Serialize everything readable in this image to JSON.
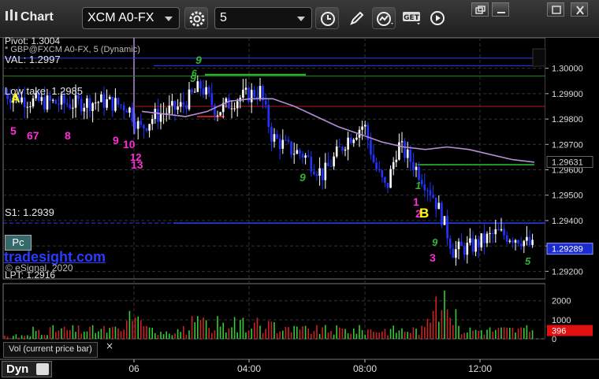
{
  "window": {
    "title": "Chart"
  },
  "toolbar": {
    "symbol": "XCM A0-FX",
    "interval": "5",
    "icons": [
      "settings-gear-icon",
      "clock-icon",
      "pencil-icon",
      "study-icon",
      "get-icon",
      "play-icon",
      "restore-icon",
      "minimize-icon",
      "maximize-icon",
      "close-icon"
    ],
    "get_label": "GET"
  },
  "legend": {
    "pivot": "Pivot: 1.3004",
    "study": "* GBP@FXCM A0-FX, 5 (Dynamic)",
    "val": "VAL: 1.2997",
    "lowtake": "Low take: 1.2985",
    "s1": "S1: 1.2939",
    "lpt": "LPT: 1.2916"
  },
  "brand": {
    "logo": "tradesight.com",
    "copyright": "© eSignal, 2020",
    "pc": "Pc"
  },
  "volume_panel": {
    "legend": "Vol (current price bar)",
    "last_volume_label": "396",
    "close_glyph": "×"
  },
  "bottom": {
    "dyn_label": "Dyn"
  },
  "colors": {
    "up": "#ffffff",
    "down": "#2233ff",
    "ma": "#b58ed8",
    "magenta": "#ff2bd6",
    "green_count": "#35b135",
    "yellow": "#ffff00",
    "resistance": "#2a3cff",
    "last_price_bg": "#1a2bd0",
    "vol_badge_bg": "#e01010"
  },
  "annotations": [
    {
      "text": "A",
      "color": "yellow"
    },
    {
      "text": "5",
      "color": "magenta"
    },
    {
      "text": "67",
      "color": "magenta"
    },
    {
      "text": "8",
      "color": "magenta"
    },
    {
      "text": "9",
      "color": "magenta"
    },
    {
      "text": "10",
      "color": "magenta"
    },
    {
      "text": "12",
      "color": "magenta"
    },
    {
      "text": "13",
      "color": "magenta"
    },
    {
      "text": "1",
      "color": "magenta"
    },
    {
      "text": "2",
      "color": "magenta"
    },
    {
      "text": "3",
      "color": "magenta"
    },
    {
      "text": "B",
      "color": "yellow"
    },
    {
      "text": "9",
      "color": "green"
    },
    {
      "text": "9",
      "color": "green"
    },
    {
      "text": "6",
      "color": "green"
    },
    {
      "text": "9",
      "color": "green"
    },
    {
      "text": "1",
      "color": "green"
    },
    {
      "text": "9",
      "color": "green"
    },
    {
      "text": "5",
      "color": "green"
    },
    {
      "text": "1",
      "color": "green"
    }
  ],
  "chart_data": {
    "type": "candlestick",
    "title": "",
    "price_axis": {
      "ylim": [
        1.2917,
        1.3012
      ],
      "ticks": [
        "1.30000",
        "1.29900",
        "1.29800",
        "1.29700",
        "1.29600",
        "1.29500",
        "1.29400",
        "1.29300",
        "1.29200"
      ]
    },
    "time_axis": {
      "ticks": [
        "06",
        "04:00",
        "08:00",
        "12:00"
      ]
    },
    "levels": [
      {
        "name": "Pivot",
        "value": 1.3004
      },
      {
        "name": "VAL",
        "value": 1.2997
      },
      {
        "name": "Low take",
        "value": 1.2985
      },
      {
        "name": "S1",
        "value": 1.2939
      },
      {
        "name": "LPT",
        "value": 1.2916
      }
    ],
    "price_labels": [
      {
        "label": "1.29631",
        "value": 1.29631
      },
      {
        "label": "1.29289",
        "value": 1.29289
      }
    ],
    "moving_average": [
      1.2983,
      1.2982,
      1.2981,
      1.2983,
      1.2987,
      1.2988,
      1.2988,
      1.2985,
      1.2981,
      1.2977,
      1.2974,
      1.2971,
      1.2969,
      1.2968,
      1.2969,
      1.2968,
      1.2966,
      1.2964,
      1.2963
    ],
    "volume": {
      "ylim": [
        0,
        2900
      ],
      "ticks": [
        "2000",
        "1000",
        "0"
      ],
      "last": 396
    }
  }
}
